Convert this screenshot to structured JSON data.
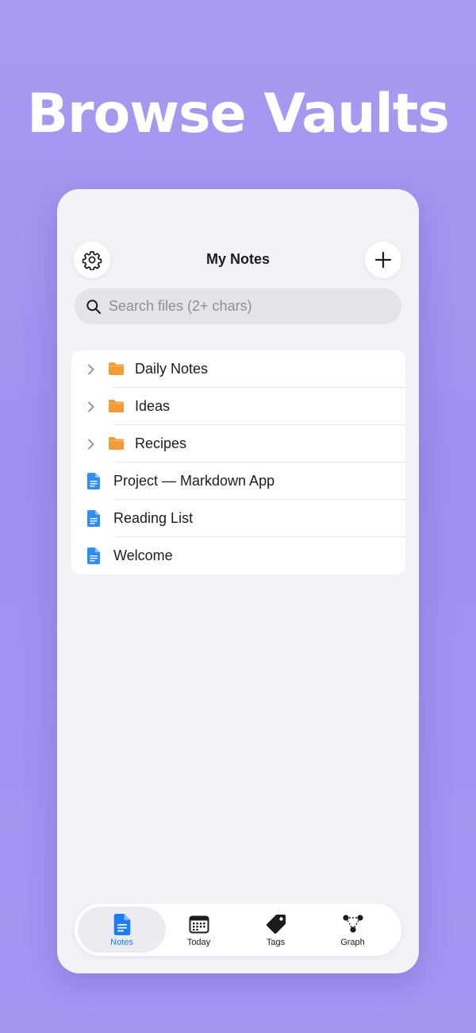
{
  "headline": "Browse Vaults",
  "nav": {
    "title": "My Notes",
    "settings_icon": "gear-icon",
    "add_icon": "plus-icon"
  },
  "search": {
    "placeholder": "Search files (2+ chars)",
    "value": ""
  },
  "colors": {
    "background": "#a99cf1",
    "folder": "#f59b36",
    "document": "#2f8ef5",
    "accent": "#1d7cf2"
  },
  "files": {
    "folders": [
      {
        "name": "Daily Notes",
        "icon": "folder-icon"
      },
      {
        "name": "Ideas",
        "icon": "folder-icon"
      },
      {
        "name": "Recipes",
        "icon": "folder-icon"
      }
    ],
    "documents": [
      {
        "name": "Project — Markdown App",
        "icon": "document-icon"
      },
      {
        "name": "Reading List",
        "icon": "document-icon"
      },
      {
        "name": "Welcome",
        "icon": "document-icon"
      }
    ]
  },
  "tabbar": {
    "active": "Notes",
    "tabs": [
      {
        "label": "Notes",
        "icon": "document-icon"
      },
      {
        "label": "Today",
        "icon": "calendar-icon"
      },
      {
        "label": "Tags",
        "icon": "tag-icon"
      },
      {
        "label": "Graph",
        "icon": "graph-icon"
      }
    ]
  }
}
